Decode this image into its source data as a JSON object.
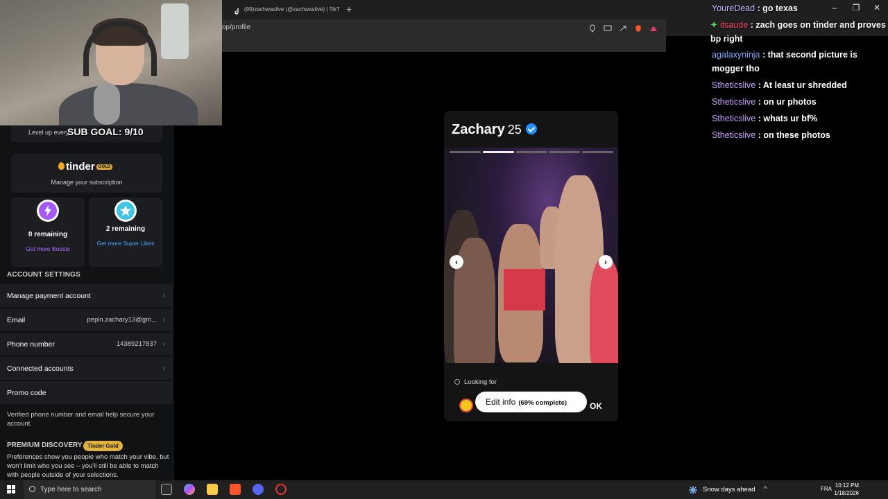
{
  "browser": {
    "tab_title": "(99)zachwaslive (@zachwaslive) | TikT",
    "url_fragment": "op/profile"
  },
  "overlay": {
    "sub_goal": "SUB GOAL: 9/10"
  },
  "settings": {
    "level_up_text": "Level up every",
    "tinder_logo": "tinder",
    "tinder_gold_badge": "GOLD",
    "manage_subscription": "Manage your subscription",
    "boosts": {
      "count": "0 remaining",
      "link": "Get more Boosts"
    },
    "superlikes": {
      "count": "2 remaining",
      "link": "Get more Super Likes"
    },
    "account_header": "ACCOUNT SETTINGS",
    "rows": [
      {
        "label": "Manage payment account",
        "value": ""
      },
      {
        "label": "Email",
        "value": "pepin.zachary13@gm..."
      },
      {
        "label": "Phone number",
        "value": "14389217837"
      },
      {
        "label": "Connected accounts",
        "value": ""
      },
      {
        "label": "Promo code",
        "value": ""
      }
    ],
    "verified_note": "Verified phone number and email help secure your account.",
    "premium_header": "PREMIUM DISCOVERY",
    "premium_badge": "Tinder Gold",
    "premium_desc": "Preferences show you people who match your vibe, but won't limit who you see – you'll still be able to match with people outside of your selections."
  },
  "profile": {
    "name": "Zachary",
    "age": "25",
    "photo_count": 5,
    "active_photo_index": 1,
    "looking_for_label": "Looking for",
    "edit_label": "Edit info",
    "completion": "(69% complete)",
    "ok_label": "OK"
  },
  "chat": [
    {
      "user": "YoureDead",
      "color": "#c9b3ff",
      "text": ": go texas"
    },
    {
      "user": "itsaude",
      "color": "#ff4d6d",
      "text": ": zach goes on tinder and proves bp right"
    },
    {
      "user": "agalaxyninja",
      "color": "#7aa7ff",
      "text": ": that second picture is mogger tho"
    },
    {
      "user": "Stheticslive",
      "color": "#c9a0ff",
      "text": ": At least ur shredded"
    },
    {
      "user": "Stheticslive",
      "color": "#c9a0ff",
      "text": ": on ur photos"
    },
    {
      "user": "Stheticslive",
      "color": "#c9a0ff",
      "text": ": whats ur bf%"
    },
    {
      "user": "Stheticslive",
      "color": "#c9a0ff",
      "text": ": on these photos"
    }
  ],
  "taskbar": {
    "search_placeholder": "Type here to search",
    "weather": "Snow days ahead",
    "language": "FRA",
    "time": "10:12 PM",
    "date": "1/18/2026"
  },
  "icons": [
    "search-icon",
    "chevron-right-icon",
    "lightning-icon",
    "star-icon",
    "verified-icon",
    "arrow-left-icon",
    "arrow-right-icon",
    "windows-start-icon"
  ]
}
